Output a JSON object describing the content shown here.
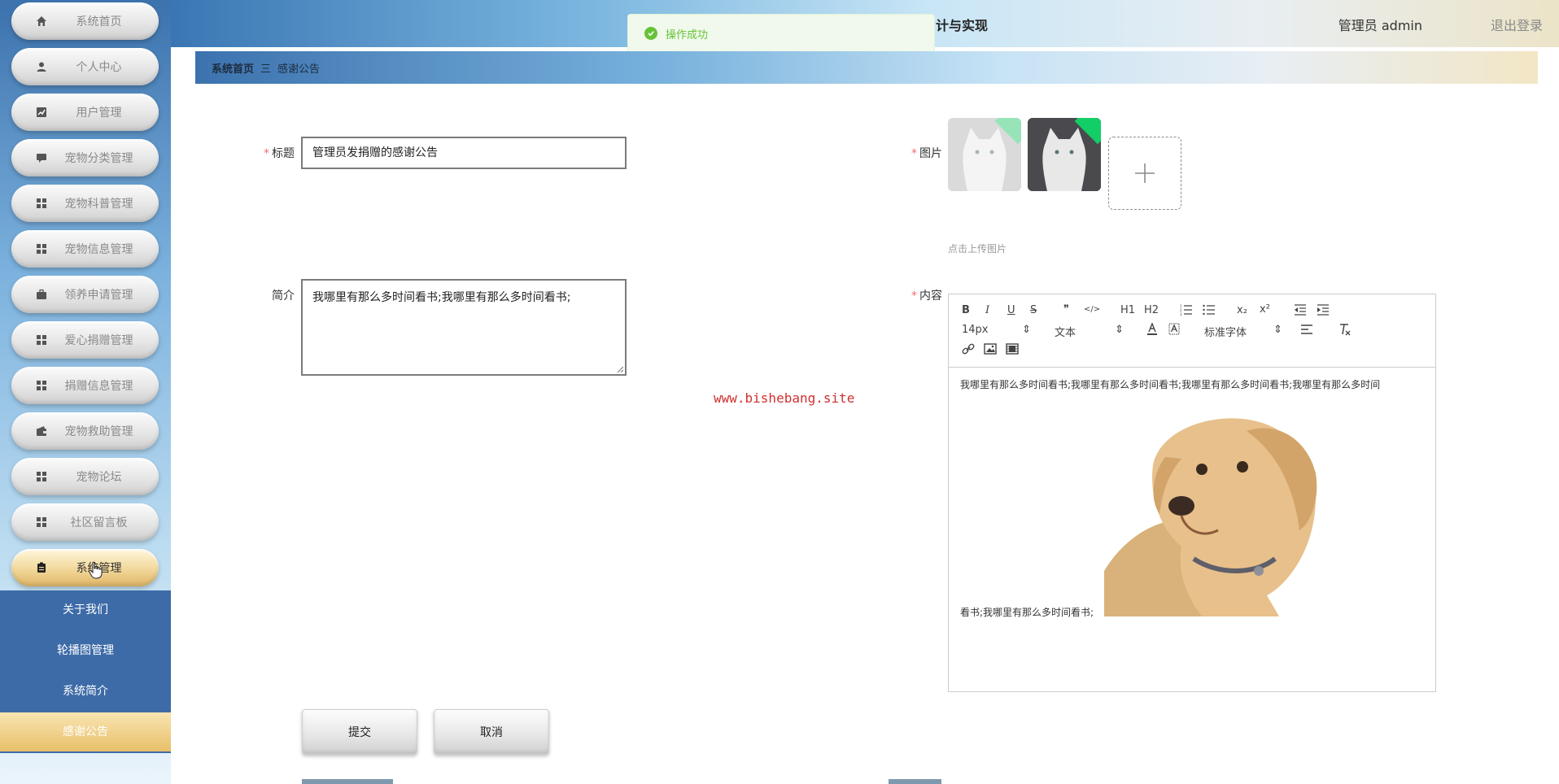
{
  "header": {
    "title": "计与实现",
    "user": "管理员 admin",
    "logout": "退出登录"
  },
  "toast": {
    "message": "操作成功"
  },
  "breadcrumb": {
    "home": "系统首页",
    "separator": "三",
    "current": "感谢公告"
  },
  "sidebar": {
    "items": [
      {
        "label": "系统首页",
        "icon": "home-icon"
      },
      {
        "label": "个人中心",
        "icon": "user-icon"
      },
      {
        "label": "用户管理",
        "icon": "chart-icon"
      },
      {
        "label": "宠物分类管理",
        "icon": "comment-icon"
      },
      {
        "label": "宠物科普管理",
        "icon": "grid-icon"
      },
      {
        "label": "宠物信息管理",
        "icon": "grid-icon"
      },
      {
        "label": "领养申请管理",
        "icon": "briefcase-icon"
      },
      {
        "label": "爱心捐赠管理",
        "icon": "grid-icon"
      },
      {
        "label": "捐赠信息管理",
        "icon": "grid-icon"
      },
      {
        "label": "宠物救助管理",
        "icon": "wallet-icon"
      },
      {
        "label": "宠物论坛",
        "icon": "grid-icon"
      },
      {
        "label": "社区留言板",
        "icon": "grid-icon"
      },
      {
        "label": "系统管理",
        "icon": "clipboard-icon"
      }
    ],
    "submenu": [
      {
        "label": "关于我们"
      },
      {
        "label": "轮播图管理"
      },
      {
        "label": "系统简介"
      },
      {
        "label": "感谢公告"
      }
    ]
  },
  "form": {
    "title_label": "标题",
    "title_value": "管理员发捐赠的感谢公告",
    "intro_label": "简介",
    "intro_value": "我哪里有那么多时间看书;我哪里有那么多时间看书;",
    "image_label": "图片",
    "upload_tip": "点击上传图片",
    "content_label": "内容",
    "submit": "提交",
    "cancel": "取消"
  },
  "editor": {
    "toolbar": {
      "bold": "B",
      "italic": "I",
      "underline": "U",
      "strike": "S",
      "quote": "❞",
      "code": "</>",
      "h1": "H1",
      "h2": "H2",
      "sub": "x₂",
      "sup": "x²",
      "size": "14px",
      "type": "文本",
      "font": "标准字体"
    },
    "content_text": "我哪里有那么多时间看书;我哪里有那么多时间看书;我哪里有那么多时间看书;我哪里有那么多时间",
    "content_text2": "看书;我哪里有那么多时间看书;"
  },
  "watermark": "www.bishebang.site",
  "colors": {
    "accent_blue": "#3d6ba7",
    "active_gold": "#e8bf6a",
    "success": "#67c23a",
    "required": "#f56c6c"
  }
}
